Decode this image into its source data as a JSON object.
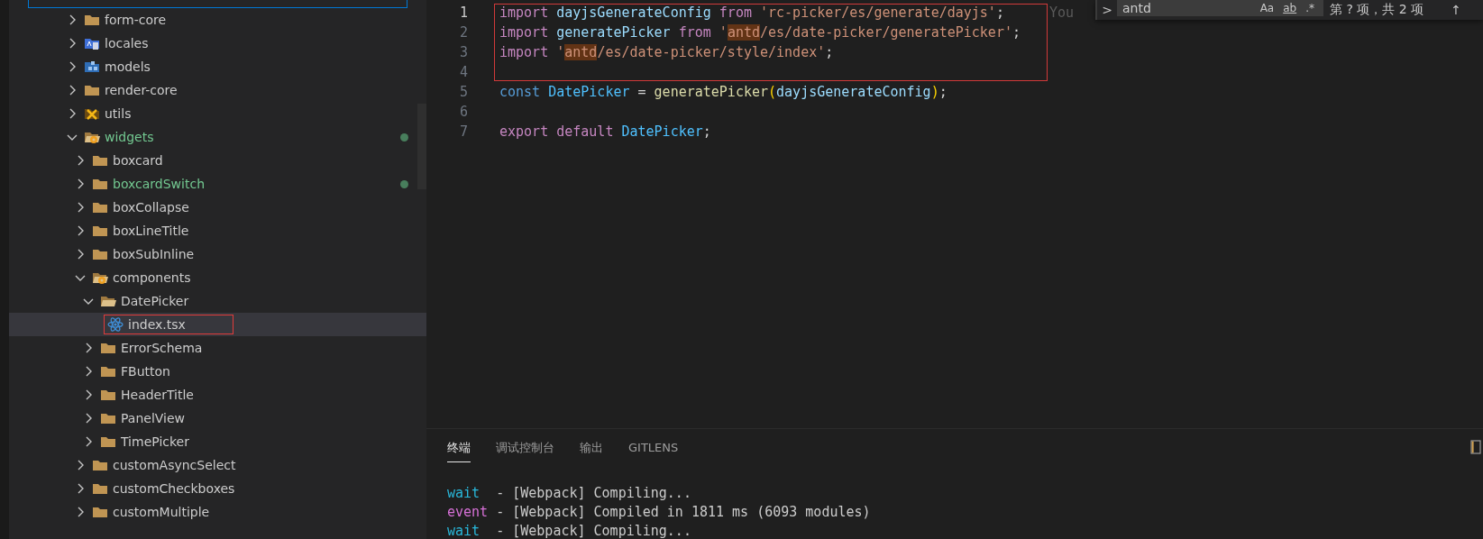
{
  "explorer": {
    "items": [
      {
        "label": "form-core",
        "kind": "folder",
        "expanded": false,
        "modified": false,
        "selected": false,
        "annotated": false
      },
      {
        "label": "locales",
        "kind": "folder-locales",
        "expanded": false,
        "modified": false,
        "selected": false,
        "annotated": false
      },
      {
        "label": "models",
        "kind": "folder-models",
        "expanded": false,
        "modified": false,
        "selected": false,
        "annotated": false
      },
      {
        "label": "render-core",
        "kind": "folder",
        "expanded": false,
        "modified": false,
        "selected": false,
        "annotated": false
      },
      {
        "label": "utils",
        "kind": "folder-utils",
        "expanded": false,
        "modified": false,
        "selected": false,
        "annotated": false
      },
      {
        "label": "widgets",
        "kind": "folder-special",
        "expanded": true,
        "modified": true,
        "selected": false,
        "annotated": false,
        "children": [
          {
            "label": "boxcard",
            "kind": "folder",
            "expanded": false,
            "modified": false,
            "selected": false,
            "annotated": false
          },
          {
            "label": "boxcardSwitch",
            "kind": "folder",
            "expanded": false,
            "modified": true,
            "selected": false,
            "annotated": false
          },
          {
            "label": "boxCollapse",
            "kind": "folder",
            "expanded": false,
            "modified": false,
            "selected": false,
            "annotated": false
          },
          {
            "label": "boxLineTitle",
            "kind": "folder",
            "expanded": false,
            "modified": false,
            "selected": false,
            "annotated": false
          },
          {
            "label": "boxSubInline",
            "kind": "folder",
            "expanded": false,
            "modified": false,
            "selected": false,
            "annotated": false
          },
          {
            "label": "components",
            "kind": "folder-special",
            "expanded": true,
            "modified": false,
            "selected": false,
            "annotated": false,
            "children": [
              {
                "label": "DatePicker",
                "kind": "folder",
                "expanded": true,
                "modified": false,
                "selected": false,
                "annotated": false,
                "children": [
                  {
                    "label": "index.tsx",
                    "kind": "react-file",
                    "modified": false,
                    "selected": true,
                    "annotated": true
                  }
                ]
              },
              {
                "label": "ErrorSchema",
                "kind": "folder",
                "expanded": false,
                "modified": false,
                "selected": false,
                "annotated": false
              },
              {
                "label": "FButton",
                "kind": "folder",
                "expanded": false,
                "modified": false,
                "selected": false,
                "annotated": false
              },
              {
                "label": "HeaderTitle",
                "kind": "folder",
                "expanded": false,
                "modified": false,
                "selected": false,
                "annotated": false
              },
              {
                "label": "PanelView",
                "kind": "folder",
                "expanded": false,
                "modified": false,
                "selected": false,
                "annotated": false
              },
              {
                "label": "TimePicker",
                "kind": "folder",
                "expanded": false,
                "modified": false,
                "selected": false,
                "annotated": false
              }
            ]
          },
          {
            "label": "customAsyncSelect",
            "kind": "folder",
            "expanded": false,
            "modified": false,
            "selected": false,
            "annotated": false
          },
          {
            "label": "customCheckboxes",
            "kind": "folder",
            "expanded": false,
            "modified": false,
            "selected": false,
            "annotated": false
          },
          {
            "label": "customMultiple",
            "kind": "folder",
            "expanded": false,
            "modified": false,
            "selected": false,
            "annotated": false
          }
        ]
      }
    ]
  },
  "editor": {
    "lines": [
      {
        "number": "1",
        "current": true,
        "boxed": true,
        "blame": "You",
        "tokens": [
          {
            "text": "import ",
            "kind": "keyword",
            "match": false
          },
          {
            "text": "dayjsGenerateConfig ",
            "kind": "variable",
            "match": false
          },
          {
            "text": "from ",
            "kind": "keyword",
            "match": false
          },
          {
            "text": "'rc-picker/es/generate/dayjs'",
            "kind": "string",
            "match": false
          },
          {
            "text": ";",
            "kind": "plain",
            "match": false
          }
        ]
      },
      {
        "number": "2",
        "current": false,
        "boxed": true,
        "tokens": [
          {
            "text": "import ",
            "kind": "keyword",
            "match": false
          },
          {
            "text": "generatePicker ",
            "kind": "variable",
            "match": false
          },
          {
            "text": "from ",
            "kind": "keyword",
            "match": false
          },
          {
            "text": "'",
            "kind": "string",
            "match": false
          },
          {
            "text": "antd",
            "kind": "string",
            "match": true
          },
          {
            "text": "/es/date-picker/generatePicker'",
            "kind": "string",
            "match": false
          },
          {
            "text": ";",
            "kind": "plain",
            "match": false
          }
        ]
      },
      {
        "number": "3",
        "current": false,
        "boxed": true,
        "tokens": [
          {
            "text": "import ",
            "kind": "keyword",
            "match": false
          },
          {
            "text": "'",
            "kind": "string",
            "match": false
          },
          {
            "text": "antd",
            "kind": "string",
            "match": true
          },
          {
            "text": "/es/date-picker/style/index'",
            "kind": "string",
            "match": false
          },
          {
            "text": ";",
            "kind": "plain",
            "match": false
          }
        ]
      },
      {
        "number": "4",
        "current": false,
        "boxed": true
      },
      {
        "number": "5",
        "current": false,
        "boxed": false,
        "tokens": [
          {
            "text": "const ",
            "kind": "storage",
            "match": false
          },
          {
            "text": "DatePicker ",
            "kind": "constant",
            "match": false
          },
          {
            "text": "= ",
            "kind": "plain",
            "match": false
          },
          {
            "text": "generatePicker",
            "kind": "function",
            "match": false
          },
          {
            "text": "(",
            "kind": "bracket",
            "match": false
          },
          {
            "text": "dayjsGenerateConfig",
            "kind": "variable",
            "match": false
          },
          {
            "text": ")",
            "kind": "bracket",
            "match": false
          },
          {
            "text": ";",
            "kind": "plain",
            "match": false
          }
        ]
      },
      {
        "number": "6",
        "current": false,
        "boxed": false
      },
      {
        "number": "7",
        "current": false,
        "boxed": false,
        "tokens": [
          {
            "text": "export ",
            "kind": "keyword",
            "match": false
          },
          {
            "text": "default ",
            "kind": "keyword",
            "match": false
          },
          {
            "text": "DatePicker",
            "kind": "constant",
            "match": false
          },
          {
            "text": ";",
            "kind": "plain",
            "match": false
          }
        ]
      }
    ],
    "find": {
      "toggle": ">",
      "value": "antd",
      "options": [
        "Aa",
        "ab",
        ".*"
      ],
      "result": "第 ? 项，共 2 项",
      "previous": "↑"
    }
  },
  "panel": {
    "tabs": [
      {
        "label": "终端",
        "selected": true
      },
      {
        "label": "调试控制台",
        "selected": false
      },
      {
        "label": "输出",
        "selected": false
      },
      {
        "label": "GITLENS",
        "selected": false
      }
    ],
    "terminal": [
      {
        "kind": "wait",
        "prefix": "wait",
        "message": "- [Webpack] Compiling..."
      },
      {
        "kind": "event",
        "prefix": "event",
        "message": "- [Webpack] Compiled in 1811 ms (6093 modules)"
      },
      {
        "kind": "wait",
        "prefix": "wait",
        "message": "- [Webpack] Compiling..."
      }
    ]
  }
}
